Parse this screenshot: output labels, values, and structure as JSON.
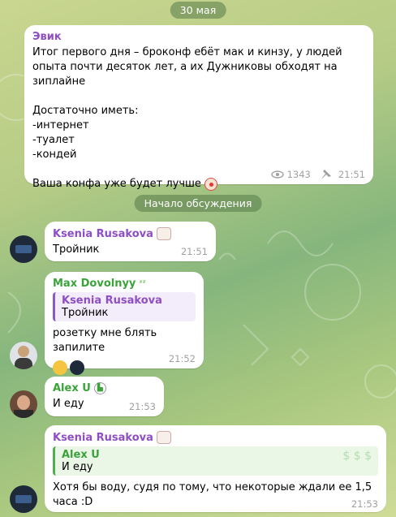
{
  "date_pill": "30 мая",
  "discussion_pill": "Начало обсуждения",
  "channel_post": {
    "author": "Эвик",
    "text": "Итог первого дня – броконф ебёт мак и кинзу, у людей опыта почти десяток лет, а их Дужниковы обходят на зиплайне\n\nДостаточно иметь:\n-интернет\n-туалет\n-кондей\n\nВаша конфа уже будет лучше",
    "views": "1343",
    "time": "21:51"
  },
  "messages": [
    {
      "author": "Ksenia Rusakova",
      "text": "Тройник",
      "time": "21:51"
    },
    {
      "author": "Max Dovolnyy",
      "quote_author": "Ksenia Rusakova",
      "quote_text": "Тройник",
      "text": "розетку мне блять запилите",
      "time": "21:52"
    },
    {
      "author": "Alex U",
      "text": "И еду",
      "time": "21:53"
    },
    {
      "author": "Ksenia Rusakova",
      "quote_author": "Alex U",
      "quote_text": "И еду",
      "text": "Хотя бы воду, судя по тому, что некоторые ждали ее 1,5 часа :D",
      "time": "21:53"
    }
  ],
  "colors": {
    "ksenia": "#8f4fc4",
    "max": "#3aa33a",
    "alex": "#3aa33a",
    "evik": "#8f4fc4"
  }
}
